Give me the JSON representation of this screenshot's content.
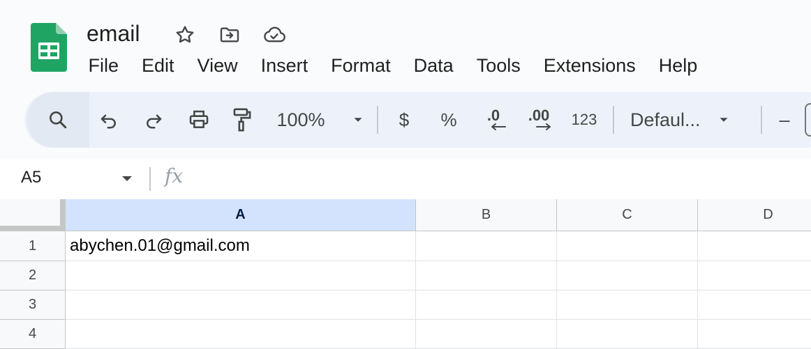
{
  "document": {
    "title": "email"
  },
  "menu": [
    "File",
    "Edit",
    "View",
    "Insert",
    "Format",
    "Data",
    "Tools",
    "Extensions",
    "Help"
  ],
  "toolbar": {
    "zoom": "100%",
    "currency": "$",
    "percent": "%",
    "decrease_decimal": ".0",
    "increase_decimal": ".00",
    "number_format": "123",
    "font": "Defaul...",
    "font_size_minus": "–"
  },
  "formula_bar": {
    "cell_ref": "A5",
    "fx": "fx",
    "value": ""
  },
  "grid": {
    "columns": [
      "A",
      "B",
      "C",
      "D"
    ],
    "selected_column": "A",
    "rows": [
      {
        "num": "1",
        "cells": [
          "abychen.01@gmail.com",
          "",
          "",
          ""
        ]
      },
      {
        "num": "2",
        "cells": [
          "",
          "",
          "",
          ""
        ]
      },
      {
        "num": "3",
        "cells": [
          "",
          "",
          "",
          ""
        ]
      },
      {
        "num": "4",
        "cells": [
          "",
          "",
          "",
          ""
        ]
      }
    ]
  },
  "colors": {
    "brand_green": "#1fa463",
    "selected_header": "#d3e3fd",
    "toolbar_bg": "#edf2fa"
  }
}
